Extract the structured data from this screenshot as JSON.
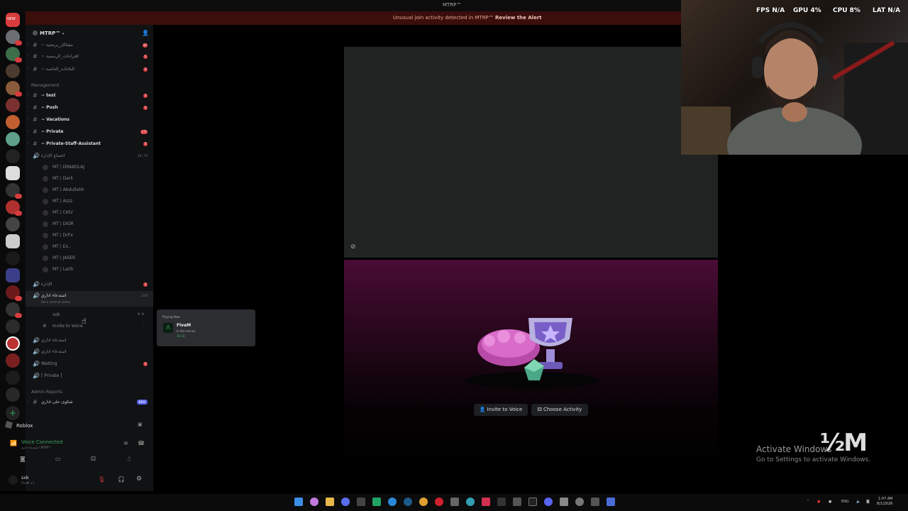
{
  "window": {
    "title": "MTRP™"
  },
  "alert": {
    "message": "Unusual join activity detected in MTRP™",
    "action": "Review the Alert"
  },
  "rail": {
    "top_badge": "NEW"
  },
  "server": {
    "name": "MTRP™"
  },
  "channels_top": [
    {
      "label": "~ مشاكل_برمجية",
      "count": "32"
    },
    {
      "label": "~ اقتراحات_الرسمية",
      "count": "5"
    },
    {
      "label": "~ البلاغات_الخاصة",
      "count": "5"
    }
  ],
  "categories": {
    "management": "Management",
    "admin_reports": "Admin Reports"
  },
  "channels_mgmt": [
    {
      "label": "~ test",
      "count": "5"
    },
    {
      "label": "~ Push",
      "count": "5"
    },
    {
      "label": "~ Vacations",
      "count": ""
    },
    {
      "label": "~ Private",
      "count": "171"
    },
    {
      "label": "~ Private-Staff-Assistant",
      "count": "5"
    }
  ],
  "voice1": {
    "label": "اجتماع الإدارة",
    "counts": "10 | 79"
  },
  "members": [
    "MT | DRAKOLAJ",
    "MT | Dark",
    "MT | Abdullahh",
    "MT | Azzz",
    "MT | CKIV",
    "MT | DIOR",
    "MT | DrFx",
    "MT | Ex..",
    "MT | JASER",
    "MT | Laith"
  ],
  "voice2": {
    "label": "الإدارة",
    "count": "2"
  },
  "voice3": {
    "label": "استدعاء اداري",
    "status": "Set a channel status",
    "counts": "1/10"
  },
  "self_member": "sxb",
  "invite_to_voice": "Invite to Voice",
  "voice_more": [
    {
      "label": "استدعاء اداري"
    },
    {
      "label": "استدعاء اداري"
    },
    {
      "label": "Waiting",
      "count": "5"
    },
    {
      "label": "[ Private ]"
    }
  ],
  "admin_channel": {
    "label": "شكوى-على-اداري",
    "badge": "NEW"
  },
  "bottom": {
    "game": "Roblox",
    "voice_connected": "Voice Connected",
    "voice_sub": "استدعاء اداري / MTRP™",
    "user": "sxb",
    "user_status": "FiveM +1"
  },
  "popup": {
    "header": "Playing Now",
    "game": "FiveM",
    "detail": "In the menus",
    "time": "20:38"
  },
  "activity": {
    "invite": "Invite to Voice",
    "choose": "Choose Activity"
  },
  "overlay": {
    "fps_label": "FPS",
    "fps_value": "N/A",
    "gpu_label": "GPU",
    "gpu_value": "4%",
    "cpu_label": "CPU",
    "cpu_value": "8%",
    "lat_label": "LAT",
    "lat_value": "N/A"
  },
  "watermark": {
    "activate": "Activate Windows",
    "sub": "Go to Settings to activate Windows.",
    "logo": "½M"
  },
  "taskbar": {
    "lang": "ENG",
    "time": "1:07 AM",
    "date": "8/1/2026"
  },
  "colors": {
    "accent_red": "#d83c3e",
    "voice_green": "#3ba55d",
    "alert_bg": "#3a0e0b"
  }
}
